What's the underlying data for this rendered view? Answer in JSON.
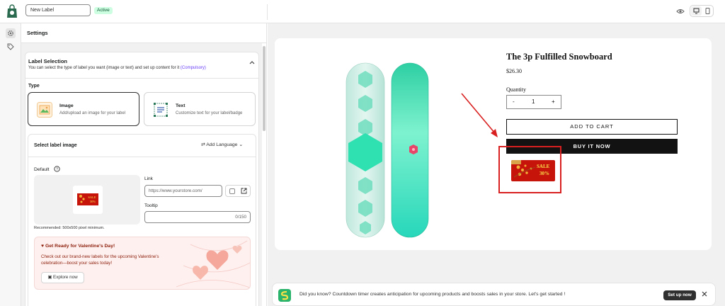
{
  "topbar": {
    "label_name": "New Label",
    "status": "Active"
  },
  "panel": {
    "title": "Settings",
    "section": {
      "title": "Label Selection",
      "description": "You can select the type of label you want (image or text) and set up content for it",
      "compulsory": "(Compulsory)",
      "type_label": "Type",
      "types": [
        {
          "name": "Image",
          "description": "Add/upload an image for your label"
        },
        {
          "name": "Text",
          "description": "Customize text for your label/badge"
        }
      ]
    },
    "image_card": {
      "title": "Select label image",
      "add_language": "Add Language",
      "default_label": "Default",
      "recommendation": "Recommended: 500x500 pixel minimum.",
      "link_label": "Link",
      "link_placeholder": "https://www.yourstore.com/",
      "tooltip_label": "Tooltip",
      "tooltip_count": "0/150"
    },
    "promo": {
      "title": "Get Ready for Valentine's Day!",
      "text": "Check out our brand-new labels for the upcoming Valentine's celebration—boost your sales today!",
      "button": "Explore now"
    }
  },
  "preview": {
    "product_title": "The 3p Fulfilled Snowboard",
    "price": "$26.30",
    "quantity_label": "Quantity",
    "quantity_minus": "-",
    "quantity_value": "1",
    "quantity_plus": "+",
    "add_to_cart": "ADD TO CART",
    "buy_now": "BUY IT NOW",
    "badge_text": "SALE",
    "badge_percent": "30%"
  },
  "notice": {
    "text": "Did you know? Countdown timer creates anticipation for upcoming products and boosts sales in your store. Let's get started !",
    "button": "Set up now"
  },
  "colors": {
    "accent_purple": "#6a3ff5",
    "active_badge": "#cdfee1",
    "annotation_red": "#d92020",
    "board_teal": "#2fe0b0",
    "sale_red": "#c6140b"
  },
  "icons": {
    "app_logo": "shopping-bag-logo-icon",
    "preview": "eye-icon",
    "desktop": "desktop-icon",
    "mobile": "mobile-icon",
    "rail_settings": "gear-icon",
    "rail_label": "tag-icon",
    "collapse": "chevron-up-icon",
    "language": "translate-icon",
    "help": "question-circle-icon",
    "external_link": "external-link-icon",
    "promo": "heart-icon",
    "explore": "calendar-icon",
    "dismiss": "close-icon"
  }
}
